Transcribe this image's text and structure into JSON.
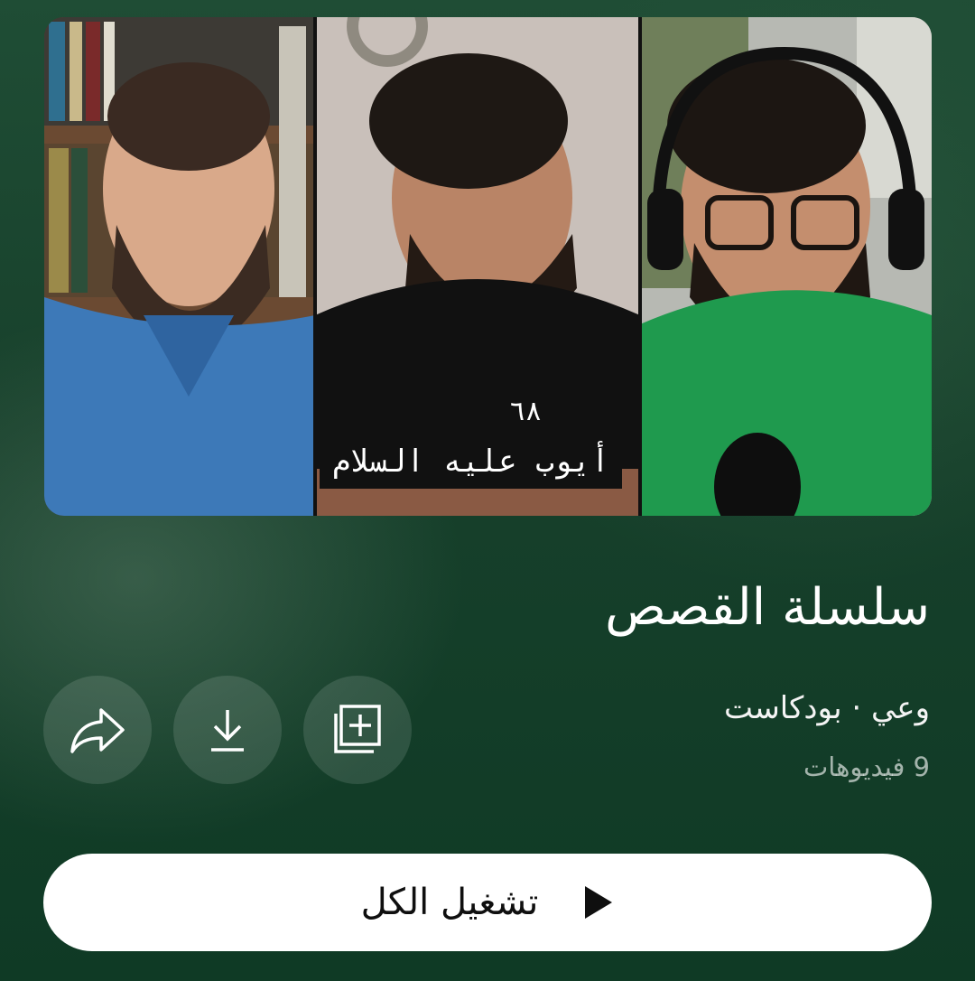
{
  "thumbnail": {
    "episode_number": "٦٨",
    "episode_title": "أيوب عليه السلام"
  },
  "playlist": {
    "title": "سلسلة القصص",
    "channel_line": "وعي · بودكاست",
    "video_count": "9 فيديوهات"
  },
  "actions": {
    "share_icon": "share-icon",
    "download_icon": "download-icon",
    "save_icon": "add-to-library-icon"
  },
  "play_all": {
    "label": "تشغيل الكل",
    "icon": "play-icon"
  },
  "colors": {
    "background": "#17402b",
    "button_bg": "#ffffff",
    "secondary_text": "#a9b4ad"
  }
}
